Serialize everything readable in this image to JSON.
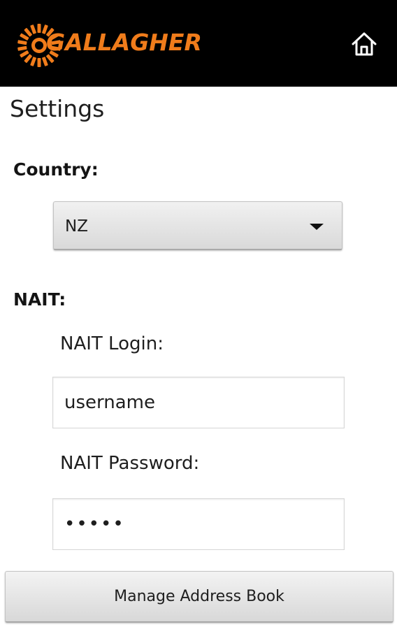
{
  "header": {
    "brand": "GALLAGHER",
    "home_icon": "home-icon",
    "background_color": "#000000",
    "brand_color": "#f07c1b"
  },
  "page": {
    "title": "Settings"
  },
  "country": {
    "label": "Country:",
    "selected": "NZ",
    "dropdown_icon": "chevron-down-icon"
  },
  "nait": {
    "label": "NAIT:",
    "login_label": "NAIT Login:",
    "login_value": "username",
    "password_label": "NAIT Password:",
    "password_value": "•••••"
  },
  "actions": {
    "address_book_label": "Manage Address Book"
  }
}
